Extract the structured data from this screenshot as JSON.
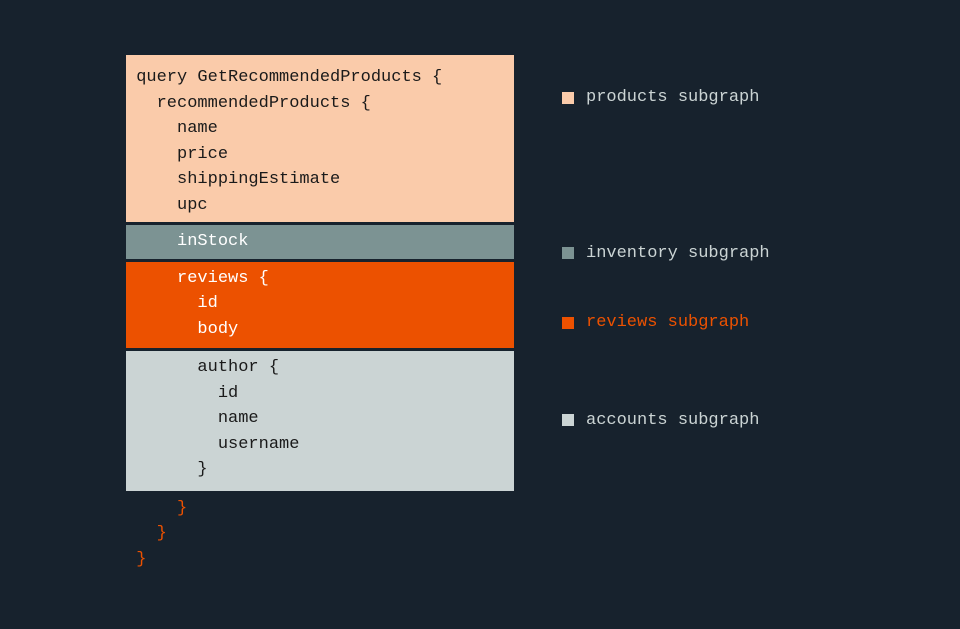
{
  "code": {
    "products": " query GetRecommendedProducts {\n   recommendedProducts {\n     name\n     price\n     shippingEstimate\n     upc",
    "inventory": "     inStock",
    "reviews": "     reviews {\n       id\n       body",
    "accounts": "       author {\n         id\n         name\n         username\n       }",
    "closing": "     }\n   }\n }"
  },
  "legend": {
    "products": "products subgraph",
    "inventory": "inventory subgraph",
    "reviews": "reviews subgraph",
    "accounts": "accounts subgraph"
  },
  "colors": {
    "products": "#facbaa",
    "inventory": "#7c9393",
    "reviews": "#ec5100",
    "accounts": "#cbd4d4",
    "background": "#17222d"
  }
}
